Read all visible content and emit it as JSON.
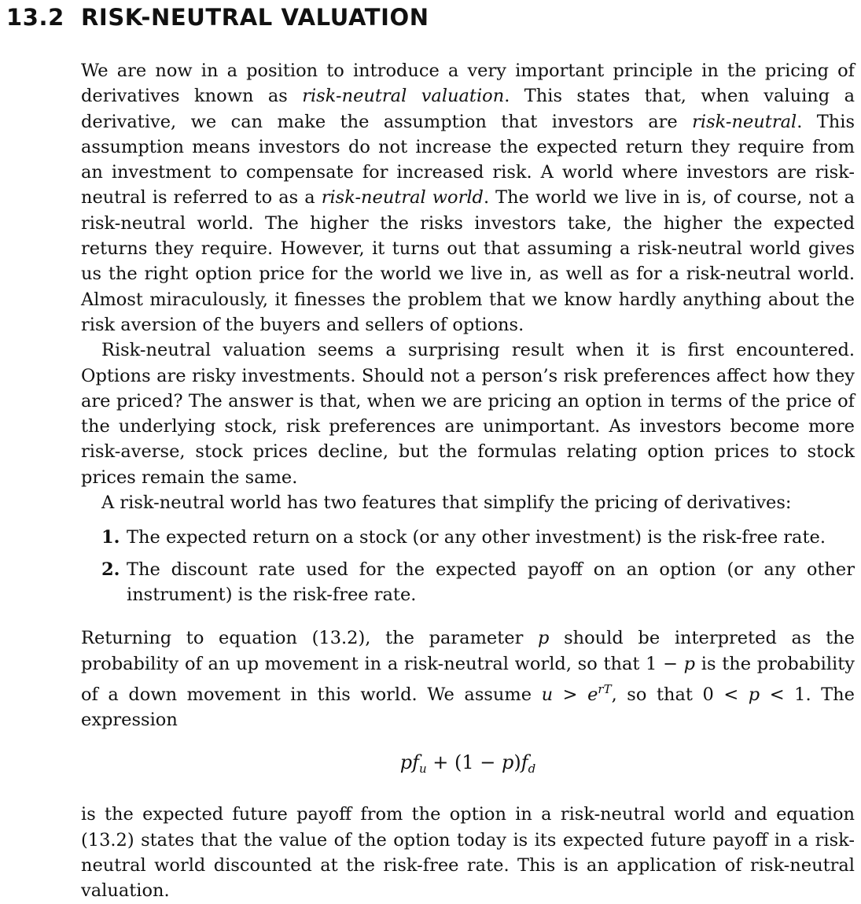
{
  "section": {
    "number": "13.2",
    "title": "RISK-NEUTRAL VALUATION"
  },
  "para1": {
    "a": "We are now in a position to introduce a very important principle in the pricing of derivatives known as ",
    "em1": "risk-neutral valuation",
    "b": ". This states that, when valuing a derivative, we can make the assumption that investors are ",
    "em2": "risk-neutral",
    "c": ". This assumption means investors do not increase the expected return they require from an investment to compensate for increased risk. A world where investors are risk-neutral is referred to as a ",
    "em3": "risk-neutral world",
    "d": ". The world we live in is, of course, not a risk-neutral world. The higher the risks investors take, the higher the expected returns they require. However, it turns out that assuming a risk-neutral world gives us the right option price for the world we live in, as well as for a risk-neutral world. Almost miraculously, it finesses the problem that we know hardly anything about the risk aversion of the buyers and sellers of options."
  },
  "para2": "Risk-neutral valuation seems a surprising result when it is first encountered. Options are risky investments. Should not a person’s risk preferences affect how they are priced? The answer is that, when we are pricing an option in terms of the price of the underlying stock, risk preferences are unimportant. As investors become more risk-averse, stock prices decline, but the formulas relating option prices to stock prices remain the same.",
  "para3": "A risk-neutral world has two features that simplify the pricing of derivatives:",
  "list": [
    {
      "num": "1.",
      "text": "The expected return on a stock (or any other investment) is the risk-free rate."
    },
    {
      "num": "2.",
      "text": "The discount rate used for the expected payoff on an option (or any other instrument) is the risk-free rate."
    }
  ],
  "para4": {
    "a": "Returning to equation (13.2), the parameter ",
    "p1": "p",
    "b": " should be interpreted as the probability of an up movement in a risk-neutral world, so that 1 − ",
    "p2": "p",
    "c": " is the probability of a down movement in this world. We assume ",
    "u": "u",
    "gt": " > ",
    "e": "e",
    "exp": "rT",
    "d": ", so that 0 < ",
    "p3": "p",
    "e2": " < 1. The expression"
  },
  "equation": {
    "p1": "p",
    "f1": "f",
    "sub1": "u",
    "mid": " + (1 − ",
    "p2": "p",
    "close": ")",
    "f2": "f",
    "sub2": "d"
  },
  "para5": "is the expected future payoff from the option in a risk-neutral world and equation (13.2) states that the value of the option today is its expected future payoff in a risk-neutral world discounted at the risk-free rate. This is an application of risk-neutral valuation."
}
